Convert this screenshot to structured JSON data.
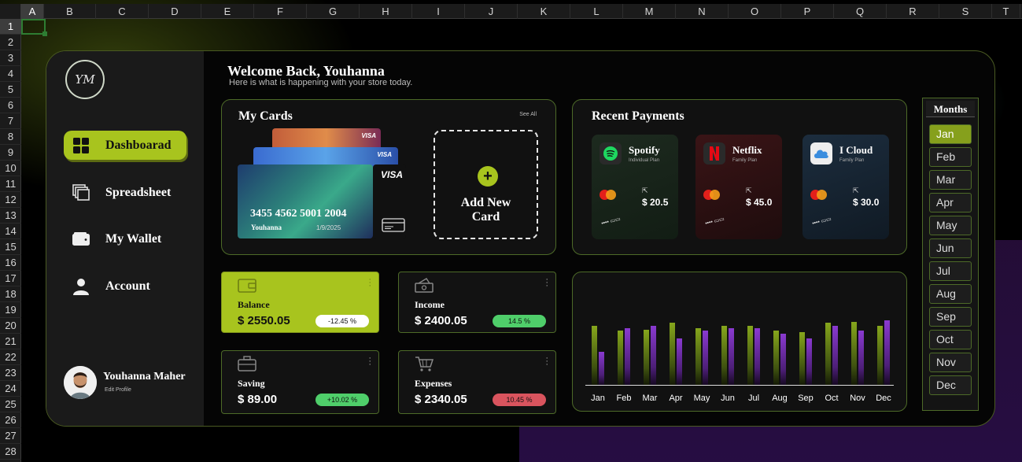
{
  "spreadsheet": {
    "columns": [
      "A",
      "B",
      "C",
      "D",
      "E",
      "F",
      "G",
      "H",
      "I",
      "J",
      "K",
      "L",
      "M",
      "N",
      "O",
      "P",
      "Q",
      "R",
      "S",
      "T"
    ],
    "rows": [
      "1",
      "2",
      "3",
      "4",
      "5",
      "6",
      "7",
      "8",
      "9",
      "10",
      "11",
      "12",
      "13",
      "14",
      "15",
      "16",
      "17",
      "18",
      "19",
      "20",
      "21",
      "22",
      "23",
      "24",
      "25",
      "26",
      "27",
      "28"
    ]
  },
  "logo": "YM",
  "nav": [
    {
      "label": "Dashboarad",
      "icon": "dashboard-grid-icon"
    },
    {
      "label": "Spreadsheet",
      "icon": "stacked-sheets-icon"
    },
    {
      "label": "My Wallet",
      "icon": "wallet-icon"
    },
    {
      "label": "Account",
      "icon": "person-icon"
    }
  ],
  "profile": {
    "name": "Youhanna Maher",
    "edit_label": "Edit Profile"
  },
  "header": {
    "title": "Welcome Back, Youhanna",
    "subtitle": "Here is what is happening with your store today."
  },
  "my_cards": {
    "title": "My Cards",
    "see_all": "See All",
    "brand": "VISA",
    "card_number": "3455 4562 5001 2004",
    "card_holder": "Youhanna",
    "card_date": "1/9/2025",
    "add_new_line1": "Add New",
    "add_new_line2": "Card"
  },
  "recent_payments": {
    "title": "Recent Payments",
    "items": [
      {
        "name": "Spotify",
        "plan": "Individual Plan",
        "amount": "$ 20.5"
      },
      {
        "name": "Netflix",
        "plan": "Family Plan",
        "amount": "$ 45.0"
      },
      {
        "name": "I Cloud",
        "plan": "Family Plan",
        "amount": "$ 30.0"
      }
    ]
  },
  "tiles": [
    {
      "label": "Balance",
      "value": "$ 2550.05",
      "change": "-12.45 %",
      "icon": "wallet-icon"
    },
    {
      "label": "Income",
      "value": "$ 2400.05",
      "change": "14.5 %",
      "icon": "cash-icon"
    },
    {
      "label": "Saving",
      "value": "$ 89.00",
      "change": "+10.02 %",
      "icon": "briefcase-icon"
    },
    {
      "label": "Expenses",
      "value": "$ 2340.05",
      "change": "10.45 %",
      "icon": "cart-icon"
    }
  ],
  "colors": {
    "accent": "#a8c41e",
    "positive": "#4fce6a",
    "negative": "#d9545e",
    "purple_bar": "#7b2fb0"
  },
  "chart_data": {
    "type": "bar",
    "categories": [
      "Jan",
      "Feb",
      "Mar",
      "Apr",
      "May",
      "Jun",
      "Jul",
      "Aug",
      "Sep",
      "Oct",
      "Nov",
      "Dec"
    ],
    "series": [
      {
        "values": [
          75,
          69,
          70,
          79,
          72,
          75,
          75,
          69,
          67,
          79,
          80,
          75
        ]
      },
      {
        "values": [
          42,
          72,
          75,
          59,
          69,
          72,
          72,
          65,
          59,
          75,
          69,
          82
        ]
      }
    ],
    "ylim": [
      0,
      100
    ],
    "grid": false
  },
  "months": {
    "title": "Months",
    "items": [
      "Jan",
      "Feb",
      "Mar",
      "Apr",
      "May",
      "Jun",
      "Jul",
      "Aug",
      "Sep",
      "Oct",
      "Nov",
      "Dec"
    ],
    "selected": "Jan"
  }
}
